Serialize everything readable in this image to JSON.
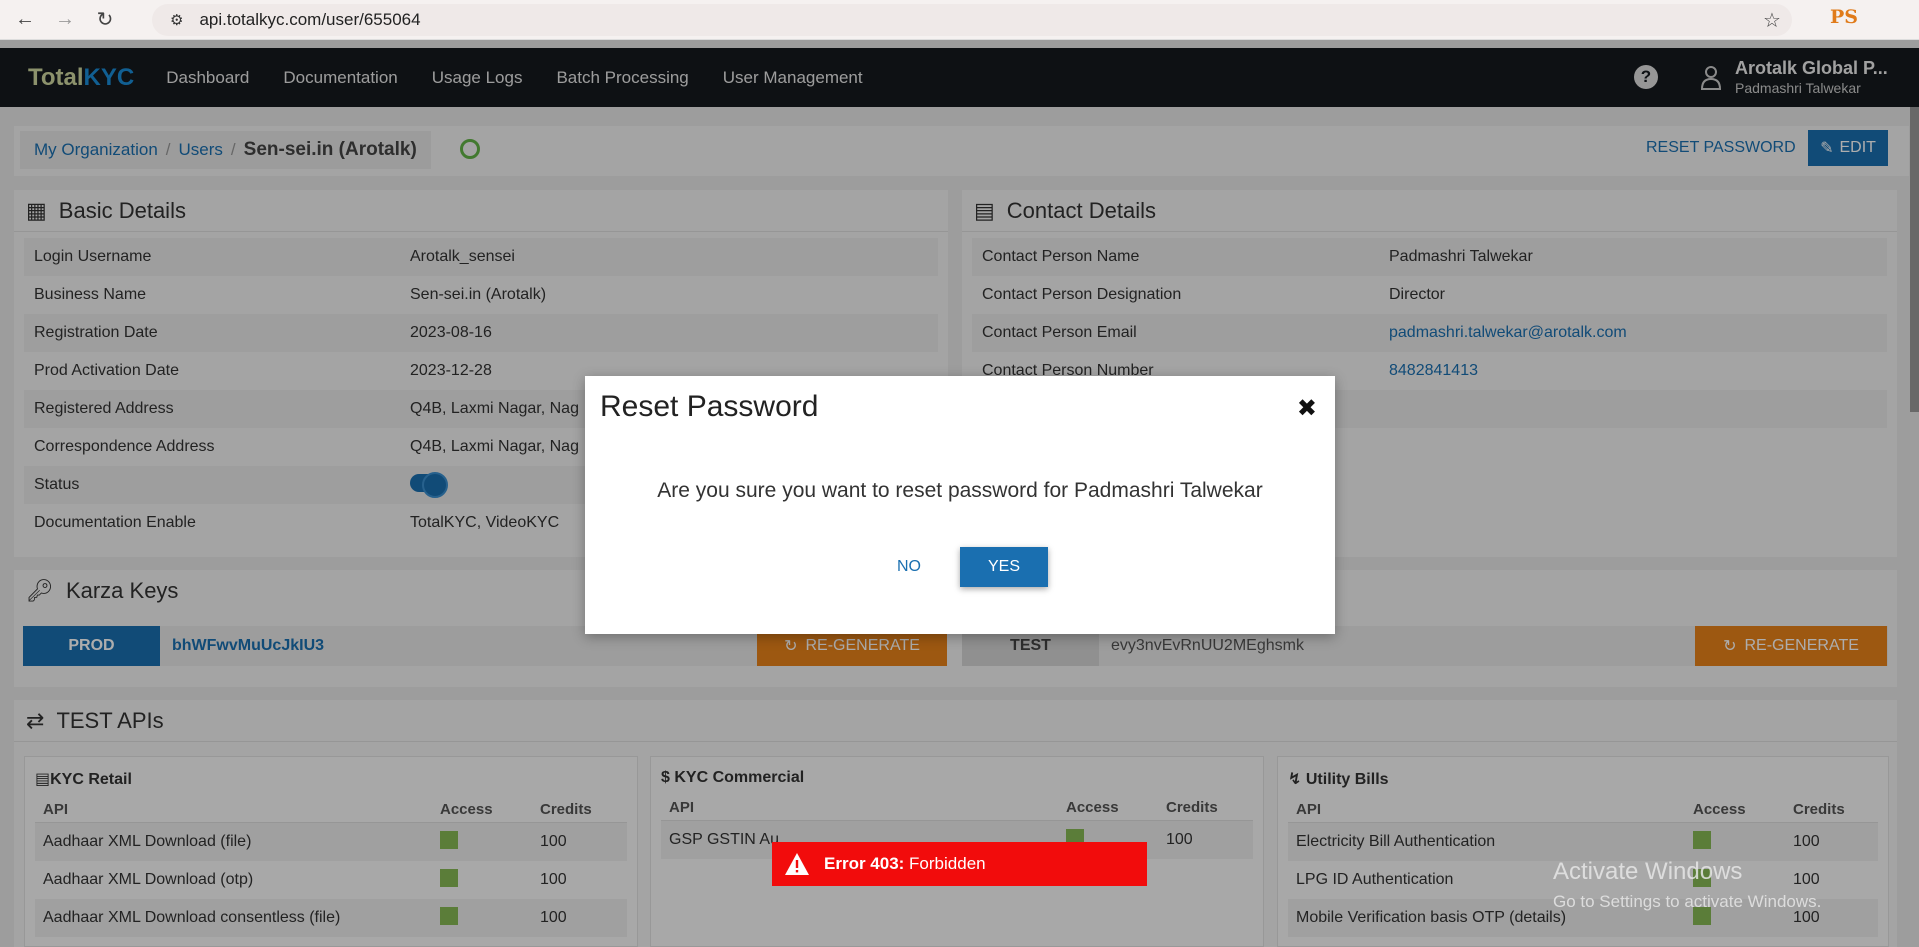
{
  "browser": {
    "url": "api.totalkyc.com/user/655064",
    "profile_initials": "PS"
  },
  "nav": {
    "brand_a": "Total",
    "brand_b": "KYC",
    "links": [
      "Dashboard",
      "Documentation",
      "Usage Logs",
      "Batch Processing",
      "User Management"
    ],
    "help": "?",
    "org_name": "Arotalk Global P...",
    "user_name": "Padmashri Talwekar"
  },
  "breadcrumb": {
    "items": [
      "My Organization",
      "Users"
    ],
    "current": "Sen-sei.in (Arotalk)"
  },
  "actions": {
    "reset_password": "RESET PASSWORD",
    "edit": "EDIT"
  },
  "basic_details": {
    "title": "Basic Details",
    "rows": [
      {
        "k": "Login Username",
        "v": "Arotalk_sensei"
      },
      {
        "k": "Business Name",
        "v": "Sen-sei.in (Arotalk)"
      },
      {
        "k": "Registration Date",
        "v": "2023-08-16"
      },
      {
        "k": "Prod Activation Date",
        "v": "2023-12-28"
      },
      {
        "k": "Registered Address",
        "v": "Q4B, Laxmi Nagar, Nag"
      },
      {
        "k": "Correspondence Address",
        "v": "Q4B, Laxmi Nagar, Nag"
      },
      {
        "k": "Status",
        "v": ""
      },
      {
        "k": "Documentation Enable",
        "v": "TotalKYC, VideoKYC"
      }
    ]
  },
  "contact_details": {
    "title": "Contact Details",
    "rows": [
      {
        "k": "Contact Person Name",
        "v": "Padmashri Talwekar"
      },
      {
        "k": "Contact Person Designation",
        "v": "Director"
      },
      {
        "k": "Contact Person Email",
        "v": "padmashri.talwekar@arotalk.com"
      },
      {
        "k": "Contact Person Number",
        "v": "8482841413"
      }
    ]
  },
  "karza": {
    "title": "Karza Keys",
    "prod_label": "PROD",
    "prod_key": "bhWFwvMuUcJkIU3",
    "test_label": "TEST",
    "test_key": "evy3nvEvRnUU2MEghsmk",
    "regen": "RE-GENERATE"
  },
  "test_apis": {
    "title": "TEST APIs",
    "headers": {
      "api": "API",
      "access": "Access",
      "credits": "Credits"
    },
    "cards": [
      {
        "title": "KYC Retail",
        "rows": [
          {
            "api": "Aadhaar XML Download (file)",
            "credits": "100"
          },
          {
            "api": "Aadhaar XML Download (otp)",
            "credits": "100"
          },
          {
            "api": "Aadhaar XML Download consentless (file)",
            "credits": "100"
          }
        ]
      },
      {
        "title": "KYC Commercial",
        "rows": [
          {
            "api": "GSP GSTIN Au",
            "credits": "100"
          }
        ]
      },
      {
        "title": "Utility Bills",
        "rows": [
          {
            "api": "Electricity Bill Authentication",
            "credits": "100"
          },
          {
            "api": "LPG ID Authentication",
            "credits": "100"
          },
          {
            "api": "Mobile Verification basis OTP (details)",
            "credits": "100"
          }
        ]
      }
    ]
  },
  "modal": {
    "title": "Reset Password",
    "message": "Are you sure you want to reset password for Padmashri Talwekar",
    "no": "NO",
    "yes": "YES"
  },
  "toast": {
    "code": "Error 403:",
    "message": " Forbidden"
  },
  "watermark": {
    "line1": "Activate Windows",
    "line2": "Go to Settings to activate Windows."
  },
  "colors": {
    "primary": "#1a6fb0",
    "regen": "#e8821a",
    "error": "#f20c0c",
    "navbar": "#151a1e"
  }
}
